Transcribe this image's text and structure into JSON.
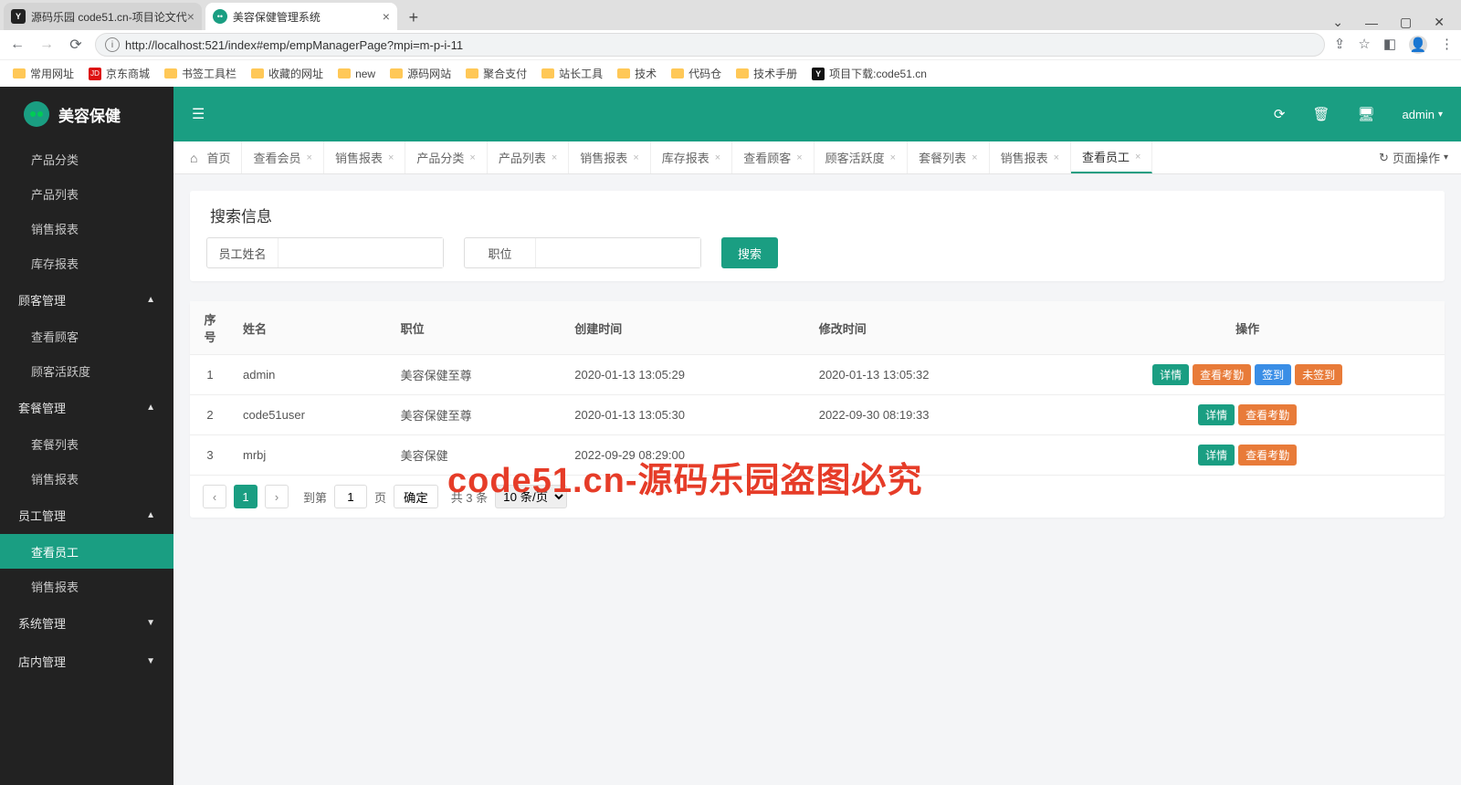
{
  "browser": {
    "tabs": [
      {
        "title": "源码乐园 code51.cn-项目论文代",
        "fav": "y"
      },
      {
        "title": "美容保健管理系统",
        "fav": "dot"
      }
    ],
    "url": "http://localhost:521/index#emp/empManagerPage?mpi=m-p-i-11",
    "bookmarks": [
      {
        "icon": "folder",
        "label": "常用网址"
      },
      {
        "icon": "jd",
        "label": "京东商城"
      },
      {
        "icon": "folder",
        "label": "书签工具栏"
      },
      {
        "icon": "folder",
        "label": "收藏的网址"
      },
      {
        "icon": "folder",
        "label": "new"
      },
      {
        "icon": "folder",
        "label": "源码网站"
      },
      {
        "icon": "folder",
        "label": "聚合支付"
      },
      {
        "icon": "folder",
        "label": "站长工具"
      },
      {
        "icon": "folder",
        "label": "技术"
      },
      {
        "icon": "folder",
        "label": "代码仓"
      },
      {
        "icon": "folder",
        "label": "技术手册"
      },
      {
        "icon": "y",
        "label": "项目下载:code51.cn"
      }
    ]
  },
  "app": {
    "brand": "美容保健",
    "user": "admin",
    "sidebar": [
      {
        "type": "item",
        "label": "产品分类"
      },
      {
        "type": "item",
        "label": "产品列表"
      },
      {
        "type": "item",
        "label": "销售报表"
      },
      {
        "type": "item",
        "label": "库存报表"
      },
      {
        "type": "head",
        "label": "顾客管理",
        "caret": "▲"
      },
      {
        "type": "item",
        "label": "查看顾客"
      },
      {
        "type": "item",
        "label": "顾客活跃度"
      },
      {
        "type": "head",
        "label": "套餐管理",
        "caret": "▲"
      },
      {
        "type": "item",
        "label": "套餐列表"
      },
      {
        "type": "item",
        "label": "销售报表"
      },
      {
        "type": "head",
        "label": "员工管理",
        "caret": "▲"
      },
      {
        "type": "item",
        "label": "查看员工",
        "active": true
      },
      {
        "type": "item",
        "label": "销售报表"
      },
      {
        "type": "head",
        "label": "系统管理",
        "caret": "▼"
      },
      {
        "type": "head",
        "label": "店内管理",
        "caret": "▼"
      }
    ],
    "pageTabs": [
      {
        "label": "首页",
        "home": true,
        "closable": false
      },
      {
        "label": "查看会员",
        "closable": true
      },
      {
        "label": "销售报表",
        "closable": true
      },
      {
        "label": "产品分类",
        "closable": true
      },
      {
        "label": "产品列表",
        "closable": true
      },
      {
        "label": "销售报表",
        "closable": true
      },
      {
        "label": "库存报表",
        "closable": true
      },
      {
        "label": "查看顾客",
        "closable": true
      },
      {
        "label": "顾客活跃度",
        "closable": true
      },
      {
        "label": "套餐列表",
        "closable": true
      },
      {
        "label": "销售报表",
        "closable": true
      },
      {
        "label": "查看员工",
        "closable": true,
        "current": true
      }
    ],
    "pageOps": "页面操作",
    "searchTitle": "搜索信息",
    "searchFields": {
      "nameLabel": "员工姓名",
      "posLabel": "职位",
      "btn": "搜索"
    },
    "table": {
      "headers": [
        "序号",
        "姓名",
        "职位",
        "创建时间",
        "修改时间",
        "操作"
      ],
      "rows": [
        {
          "idx": "1",
          "name": "admin",
          "pos": "美容保健至尊",
          "ct": "2020-01-13 13:05:29",
          "mt": "2020-01-13 13:05:32",
          "ops": [
            {
              "t": "详情",
              "c": "teal"
            },
            {
              "t": "查看考勤",
              "c": "orange"
            },
            {
              "t": "签到",
              "c": "blue"
            },
            {
              "t": "未签到",
              "c": "orange"
            }
          ]
        },
        {
          "idx": "2",
          "name": "code51user",
          "pos": "美容保健至尊",
          "ct": "2020-01-13 13:05:30",
          "mt": "2022-09-30 08:19:33",
          "ops": [
            {
              "t": "详情",
              "c": "teal"
            },
            {
              "t": "查看考勤",
              "c": "orange"
            }
          ]
        },
        {
          "idx": "3",
          "name": "mrbj",
          "pos": "美容保健",
          "ct": "2022-09-29 08:29:00",
          "mt": "",
          "ops": [
            {
              "t": "详情",
              "c": "teal"
            },
            {
              "t": "查看考勤",
              "c": "orange"
            }
          ]
        }
      ]
    },
    "pager": {
      "cur": "1",
      "gotoLabel": "到第",
      "pageLabel": "页",
      "ok": "确定",
      "total": "共 3 条",
      "perpage": "10 条/页"
    }
  },
  "watermark": "code51.cn-源码乐园盗图必究"
}
